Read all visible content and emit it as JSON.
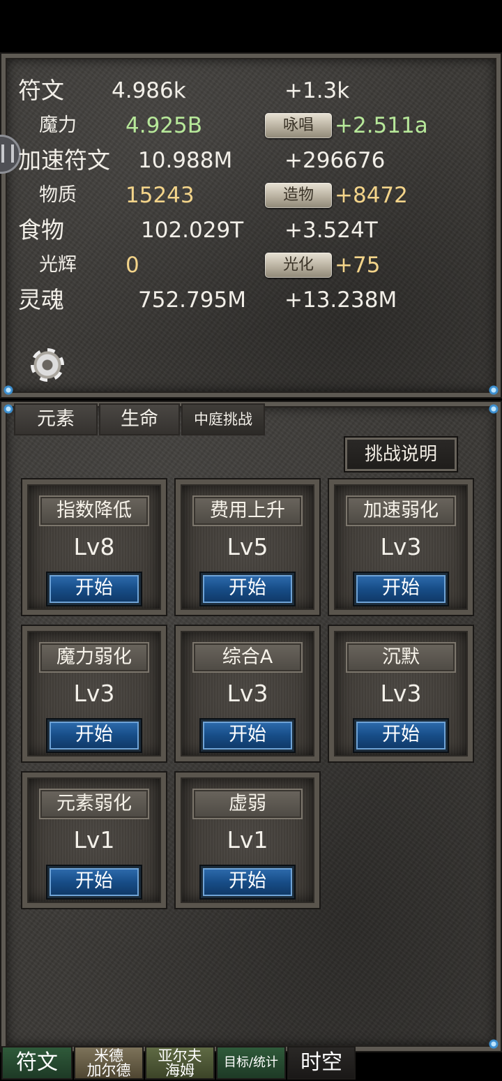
{
  "resources": [
    {
      "name": "符文",
      "value": "4.986k",
      "rate": "+1.3k",
      "style": "big",
      "value_left": 160
    },
    {
      "name": "魔力",
      "value": "4.925B",
      "rate": "+2.511a",
      "style": "small",
      "action": "咏唱",
      "color": "#b7e89a",
      "value_left": 180
    },
    {
      "name": "加速符文",
      "value": "10.988M",
      "rate": "+296676",
      "style": "big",
      "value_left": 198
    },
    {
      "name": "物质",
      "value": "15243",
      "rate": "+8472",
      "style": "small",
      "action": "造物",
      "color": "#f3d48a",
      "value_left": 180
    },
    {
      "name": "食物",
      "value": "102.029T",
      "rate": "+3.524T",
      "style": "big",
      "value_left": 202
    },
    {
      "name": "光辉",
      "value": "0",
      "rate": "+75",
      "style": "small",
      "action": "光化",
      "color": "#f3d48a",
      "value_left": 180
    },
    {
      "name": "灵魂",
      "value": "752.795M",
      "rate": "+13.238M",
      "style": "big",
      "value_left": 198
    }
  ],
  "tabs": {
    "yuansu": "元素",
    "shengming": "生命",
    "zhongting": "中庭挑战"
  },
  "explain_label": "挑战说明",
  "challenges": [
    {
      "title": "指数降低",
      "level": "Lv8",
      "start": "开始"
    },
    {
      "title": "费用上升",
      "level": "Lv5",
      "start": "开始"
    },
    {
      "title": "加速弱化",
      "level": "Lv3",
      "start": "开始"
    },
    {
      "title": "魔力弱化",
      "level": "Lv3",
      "start": "开始"
    },
    {
      "title": "综合A",
      "level": "Lv3",
      "start": "开始"
    },
    {
      "title": "沉默",
      "level": "Lv3",
      "start": "开始"
    },
    {
      "title": "元素弱化",
      "level": "Lv1",
      "start": "开始"
    },
    {
      "title": "虚弱",
      "level": "Lv1",
      "start": "开始"
    }
  ],
  "nav": {
    "fuwen": "符文",
    "mide_line1": "米德",
    "mide_line2": "加尔德",
    "yaer_line1": "亚尔夫",
    "yaer_line2": "海姆",
    "mubiao": "目标/统计",
    "shikong": "时空"
  }
}
